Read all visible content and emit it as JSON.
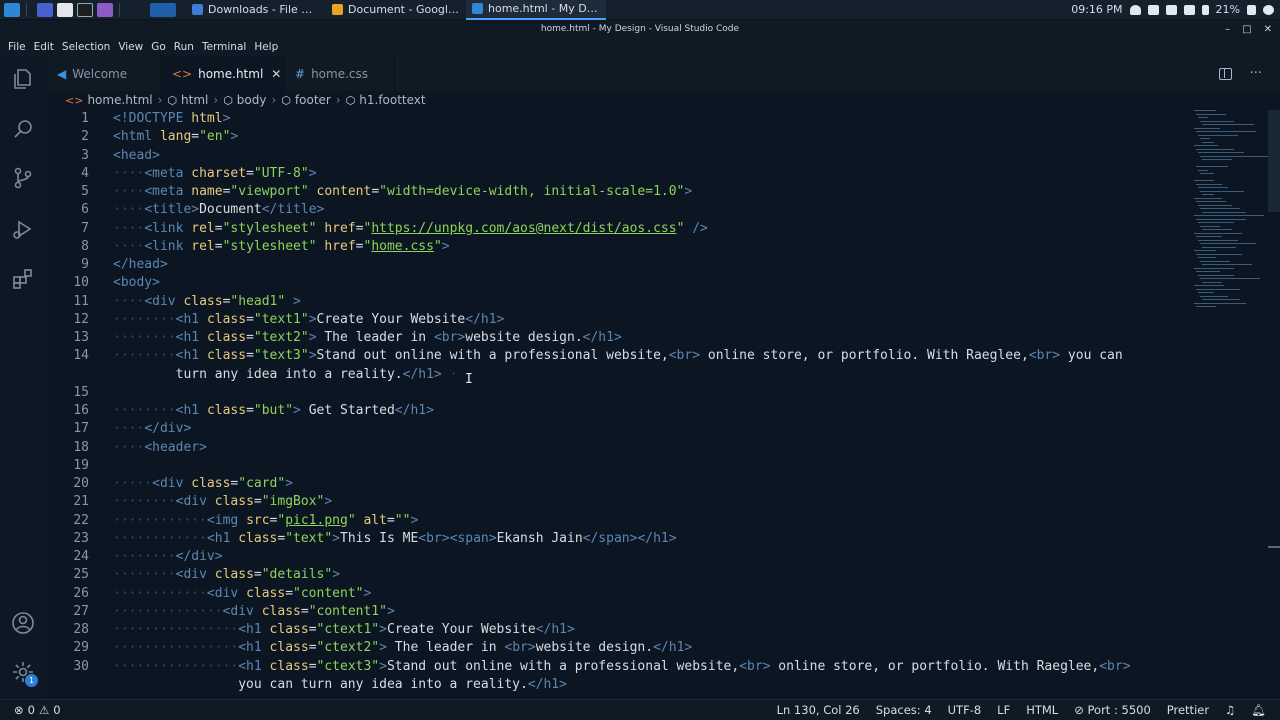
{
  "taskbar": {
    "tasks": [
      {
        "label": "Downloads - File Manag...",
        "color": "#3b7dd8"
      },
      {
        "label": "Document - Google Chr...",
        "color": "#e8a323"
      },
      {
        "label": "home.html - My Design ...",
        "color": "#2f86d6"
      }
    ],
    "clock": "09:16 PM",
    "battery": "21%"
  },
  "window": {
    "title": "home.html - My Design - Visual Studio Code",
    "controls": [
      "–",
      "□",
      "✕"
    ]
  },
  "menu": [
    "File",
    "Edit",
    "Selection",
    "View",
    "Go",
    "Run",
    "Terminal",
    "Help"
  ],
  "tabs": [
    {
      "label": "Welcome",
      "icon": "vscode-icon"
    },
    {
      "label": "home.html",
      "icon": "html-file-icon",
      "close": "✕"
    },
    {
      "label": "home.css",
      "icon": "hash-icon",
      "glyph": "#"
    }
  ],
  "tab_actions": {
    "split": "split-editor-icon",
    "more": "···"
  },
  "breadcrumb": [
    "home.html",
    "html",
    "body",
    "footer",
    "h1.foottext"
  ],
  "editor": {
    "lines": [
      {
        "n": "1",
        "ws": "",
        "tokens": [
          [
            "tg",
            "<!DOCTYPE "
          ],
          [
            "nm",
            "html"
          ],
          [
            "tg",
            ">"
          ]
        ]
      },
      {
        "n": "2",
        "ws": "",
        "tokens": [
          [
            "tg",
            "<html "
          ],
          [
            "nm",
            "lang"
          ],
          [
            "tx",
            "="
          ],
          [
            "st",
            "\"en\""
          ],
          [
            "tg",
            ">"
          ]
        ]
      },
      {
        "n": "3",
        "ws": "",
        "tokens": [
          [
            "tg",
            "<head>"
          ]
        ]
      },
      {
        "n": "4",
        "ws": "····",
        "tokens": [
          [
            "tg",
            "<meta "
          ],
          [
            "nm",
            "charset"
          ],
          [
            "tx",
            "="
          ],
          [
            "st",
            "\"UTF-8\""
          ],
          [
            "tg",
            ">"
          ]
        ]
      },
      {
        "n": "5",
        "ws": "····",
        "tokens": [
          [
            "tg",
            "<meta "
          ],
          [
            "nm",
            "name"
          ],
          [
            "tx",
            "="
          ],
          [
            "st",
            "\"viewport\" "
          ],
          [
            "nm",
            "content"
          ],
          [
            "tx",
            "="
          ],
          [
            "st",
            "\"width=device-width, initial-scale=1.0\""
          ],
          [
            "tg",
            ">"
          ]
        ]
      },
      {
        "n": "6",
        "ws": "····",
        "tokens": [
          [
            "tg",
            "<title>"
          ],
          [
            "tx",
            "Document"
          ],
          [
            "tg",
            "</title>"
          ]
        ]
      },
      {
        "n": "7",
        "ws": "····",
        "tokens": [
          [
            "tg",
            "<link "
          ],
          [
            "nm",
            "rel"
          ],
          [
            "tx",
            "="
          ],
          [
            "st",
            "\"stylesheet\" "
          ],
          [
            "nm",
            "href"
          ],
          [
            "tx",
            "="
          ],
          [
            "st",
            "\""
          ],
          [
            "stu",
            "https://unpkg.com/aos@next/dist/aos.css"
          ],
          [
            "st",
            "\""
          ],
          [
            "tg",
            " />"
          ]
        ]
      },
      {
        "n": "8",
        "ws": "····",
        "tokens": [
          [
            "tg",
            "<link "
          ],
          [
            "nm",
            "rel"
          ],
          [
            "tx",
            "="
          ],
          [
            "st",
            "\"stylesheet\" "
          ],
          [
            "nm",
            "href"
          ],
          [
            "tx",
            "="
          ],
          [
            "st",
            "\""
          ],
          [
            "stu",
            "home.css"
          ],
          [
            "st",
            "\""
          ],
          [
            "tg",
            ">"
          ]
        ]
      },
      {
        "n": "9",
        "ws": "",
        "tokens": [
          [
            "tg",
            "</head>"
          ]
        ]
      },
      {
        "n": "10",
        "ws": "",
        "tokens": [
          [
            "tg",
            "<body>"
          ]
        ]
      },
      {
        "n": "11",
        "ws": "····",
        "tokens": [
          [
            "tg",
            "<div "
          ],
          [
            "nm",
            "class"
          ],
          [
            "tx",
            "="
          ],
          [
            "st",
            "\"head1\" "
          ],
          [
            "tg",
            ">"
          ]
        ]
      },
      {
        "n": "12",
        "ws": "········",
        "tokens": [
          [
            "tg",
            "<h1 "
          ],
          [
            "nm",
            "class"
          ],
          [
            "tx",
            "="
          ],
          [
            "st",
            "\"text1\""
          ],
          [
            "tg",
            ">"
          ],
          [
            "tx",
            "Create Your Website"
          ],
          [
            "tg",
            "</h1>"
          ]
        ]
      },
      {
        "n": "13",
        "ws": "········",
        "tokens": [
          [
            "tg",
            "<h1 "
          ],
          [
            "nm",
            "class"
          ],
          [
            "tx",
            "="
          ],
          [
            "st",
            "\"text2\""
          ],
          [
            "tg",
            "> "
          ],
          [
            "tx",
            "The leader in "
          ],
          [
            "tg",
            "<br>"
          ],
          [
            "tx",
            "website design."
          ],
          [
            "tg",
            "</h1>"
          ]
        ]
      },
      {
        "n": "14",
        "ws": "········",
        "tokens": [
          [
            "tg",
            "<h1 "
          ],
          [
            "nm",
            "class"
          ],
          [
            "tx",
            "="
          ],
          [
            "st",
            "\"text3\""
          ],
          [
            "tg",
            ">"
          ],
          [
            "tx",
            "Stand out online with a professional website,"
          ],
          [
            "tg",
            "<br>"
          ],
          [
            "tx",
            " online store, or portfolio. With Raeglee,"
          ],
          [
            "tg",
            "<br>"
          ],
          [
            "tx",
            " you can"
          ]
        ]
      },
      {
        "n": "",
        "ws": "        ",
        "tokens": [
          [
            "tx",
            "turn any idea into a reality."
          ],
          [
            "tg",
            "</h1>"
          ],
          [
            "ws",
            " ·"
          ]
        ]
      },
      {
        "n": "15",
        "ws": "",
        "tokens": []
      },
      {
        "n": "16",
        "ws": "········",
        "tokens": [
          [
            "tg",
            "<h1 "
          ],
          [
            "nm",
            "class"
          ],
          [
            "tx",
            "="
          ],
          [
            "st",
            "\"but\""
          ],
          [
            "tg",
            "> "
          ],
          [
            "tx",
            "Get Started"
          ],
          [
            "tg",
            "</h1>"
          ]
        ]
      },
      {
        "n": "17",
        "ws": "····",
        "tokens": [
          [
            "tg",
            "</div>"
          ]
        ]
      },
      {
        "n": "18",
        "ws": "····",
        "tokens": [
          [
            "tg",
            "<header>"
          ]
        ]
      },
      {
        "n": "19",
        "ws": "",
        "tokens": []
      },
      {
        "n": "20",
        "ws": "·····",
        "tokens": [
          [
            "tg",
            "<div "
          ],
          [
            "nm",
            "class"
          ],
          [
            "tx",
            "="
          ],
          [
            "st",
            "\"card\""
          ],
          [
            "tg",
            ">"
          ]
        ]
      },
      {
        "n": "21",
        "ws": "········",
        "tokens": [
          [
            "tg",
            "<div "
          ],
          [
            "nm",
            "class"
          ],
          [
            "tx",
            "="
          ],
          [
            "st",
            "\"imgBox\""
          ],
          [
            "tg",
            ">"
          ]
        ]
      },
      {
        "n": "22",
        "ws": "············",
        "tokens": [
          [
            "tg",
            "<img "
          ],
          [
            "nm",
            "src"
          ],
          [
            "tx",
            "="
          ],
          [
            "st",
            "\""
          ],
          [
            "stu",
            "pic1.png"
          ],
          [
            "st",
            "\" "
          ],
          [
            "nm",
            "alt"
          ],
          [
            "tx",
            "="
          ],
          [
            "st",
            "\"\""
          ],
          [
            "tg",
            ">"
          ]
        ]
      },
      {
        "n": "23",
        "ws": "············",
        "tokens": [
          [
            "tg",
            "<h1 "
          ],
          [
            "nm",
            "class"
          ],
          [
            "tx",
            "="
          ],
          [
            "st",
            "\"text\""
          ],
          [
            "tg",
            ">"
          ],
          [
            "tx",
            "This Is ME"
          ],
          [
            "tg",
            "<br><span>"
          ],
          [
            "tx",
            "Ekansh Jain"
          ],
          [
            "tg",
            "</span></h1>"
          ]
        ]
      },
      {
        "n": "24",
        "ws": "········",
        "tokens": [
          [
            "tg",
            "</div>"
          ]
        ]
      },
      {
        "n": "25",
        "ws": "········",
        "tokens": [
          [
            "tg",
            "<div "
          ],
          [
            "nm",
            "class"
          ],
          [
            "tx",
            "="
          ],
          [
            "st",
            "\"details\""
          ],
          [
            "tg",
            ">"
          ]
        ]
      },
      {
        "n": "26",
        "ws": "············",
        "tokens": [
          [
            "tg",
            "<div "
          ],
          [
            "nm",
            "class"
          ],
          [
            "tx",
            "="
          ],
          [
            "st",
            "\"content\""
          ],
          [
            "tg",
            ">"
          ]
        ]
      },
      {
        "n": "27",
        "ws": "··············",
        "tokens": [
          [
            "tg",
            "<div "
          ],
          [
            "nm",
            "class"
          ],
          [
            "tx",
            "="
          ],
          [
            "st",
            "\"content1\""
          ],
          [
            "tg",
            ">"
          ]
        ]
      },
      {
        "n": "28",
        "ws": "················",
        "tokens": [
          [
            "tg",
            "<h1 "
          ],
          [
            "nm",
            "class"
          ],
          [
            "tx",
            "="
          ],
          [
            "st",
            "\"ctext1\""
          ],
          [
            "tg",
            ">"
          ],
          [
            "tx",
            "Create Your Website"
          ],
          [
            "tg",
            "</h1>"
          ]
        ]
      },
      {
        "n": "29",
        "ws": "················",
        "tokens": [
          [
            "tg",
            "<h1 "
          ],
          [
            "nm",
            "class"
          ],
          [
            "tx",
            "="
          ],
          [
            "st",
            "\"ctext2\""
          ],
          [
            "tg",
            "> "
          ],
          [
            "tx",
            "The leader in "
          ],
          [
            "tg",
            "<br>"
          ],
          [
            "tx",
            "website design."
          ],
          [
            "tg",
            "</h1>"
          ]
        ]
      },
      {
        "n": "30",
        "ws": "················",
        "tokens": [
          [
            "tg",
            "<h1 "
          ],
          [
            "nm",
            "class"
          ],
          [
            "tx",
            "="
          ],
          [
            "st",
            "\"ctext3\""
          ],
          [
            "tg",
            ">"
          ],
          [
            "tx",
            "Stand out online with a professional website,"
          ],
          [
            "tg",
            "<br>"
          ],
          [
            "tx",
            " online store, or portfolio. With Raeglee,"
          ],
          [
            "tg",
            "<br>"
          ]
        ]
      },
      {
        "n": "",
        "ws": "                ",
        "tokens": [
          [
            "tx",
            "you can turn any idea into a reality."
          ],
          [
            "tg",
            "</h1>"
          ]
        ]
      }
    ]
  },
  "status": {
    "errors": "0",
    "warnings": "0",
    "position": "Ln 130, Col 26",
    "spaces": "Spaces: 4",
    "encoding": "UTF-8",
    "eol": "LF",
    "language": "HTML",
    "port": "Port : 5500",
    "formatter": "Prettier"
  },
  "activity": {
    "settings_badge": "1"
  }
}
